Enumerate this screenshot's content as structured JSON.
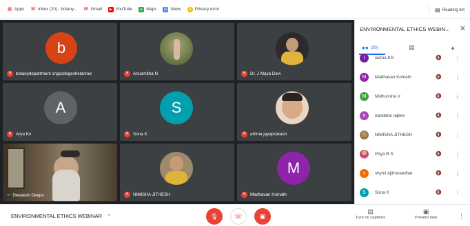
{
  "bookmarks": [
    {
      "label": "Apps",
      "icon": "apps-grid-icon",
      "color": "#ea4335"
    },
    {
      "label": "Inbox (20) - botany...",
      "icon": "gmail-icon",
      "color": "#ea4335"
    },
    {
      "label": "Gmail",
      "icon": "gmail-icon",
      "color": "#ea4335"
    },
    {
      "label": "YouTube",
      "icon": "youtube-icon",
      "color": "#ff0000"
    },
    {
      "label": "Maps",
      "icon": "maps-icon",
      "color": "#34a853"
    },
    {
      "label": "News",
      "icon": "news-icon",
      "color": "#4285f4"
    },
    {
      "label": "Privacy error",
      "icon": "globe-icon",
      "color": "#fbbc04"
    }
  ],
  "reading_list": "Reading list",
  "tiles": [
    {
      "name": "botanydepartment sngcollegechelannur",
      "kind": "letter",
      "letter": "b",
      "color": "#d84315"
    },
    {
      "name": "Anusmitha N",
      "kind": "photo",
      "color": "#7b8a5a"
    },
    {
      "name": "Dr. J Maya Devi",
      "kind": "photo",
      "color": "#2e2a2c"
    },
    {
      "name": "Arya Kn",
      "kind": "letter",
      "letter": "A",
      "color": "#5f6368"
    },
    {
      "name": "Sona K",
      "kind": "letter",
      "letter": "S",
      "color": "#00a0ae"
    },
    {
      "name": "athma jayaprakash",
      "kind": "photo",
      "color": "#c9a27e"
    },
    {
      "name": "Deepesh Deepu",
      "kind": "video",
      "color": "#8a7e6a"
    },
    {
      "name": "NIMISHA JITHESH",
      "kind": "photo",
      "color": "#8d6e3e"
    },
    {
      "name": "Madhavan Komath",
      "kind": "letter",
      "letter": "M",
      "color": "#8e24aa"
    }
  ],
  "panel": {
    "title": "ENVIRONMENTAL ETHICS WEBIN...",
    "close_icon": "close-icon",
    "people_count": "(30)",
    "participants": [
      {
        "name": "iastna KR",
        "letter": "I",
        "color": "#7b1fa2"
      },
      {
        "name": "Madhavan Komath",
        "letter": "M",
        "color": "#8e24aa"
      },
      {
        "name": "Midhunsha V",
        "letter": "M",
        "color": "#43a047"
      },
      {
        "name": "nandana rajeev",
        "letter": "n",
        "color": "#ab47bc"
      },
      {
        "name": "NIMISHA JITHESH",
        "letter": "",
        "color": "#8d6e3e"
      },
      {
        "name": "Priya R.S",
        "letter": "",
        "color": "#c2185b"
      },
      {
        "name": "shymi Ajithsreedhar",
        "letter": "s",
        "color": "#ef6c00"
      },
      {
        "name": "Sona K",
        "letter": "S",
        "color": "#00a0ae"
      }
    ]
  },
  "bottom": {
    "meeting_title": "ENVIRONMENTAL ETHICS WEBINAR",
    "captions_label": "Turn on captions",
    "present_label": "Present now",
    "mic_color": "#ea4335",
    "end_call_color": "#ffffff",
    "camera_color": "#ea4335"
  }
}
